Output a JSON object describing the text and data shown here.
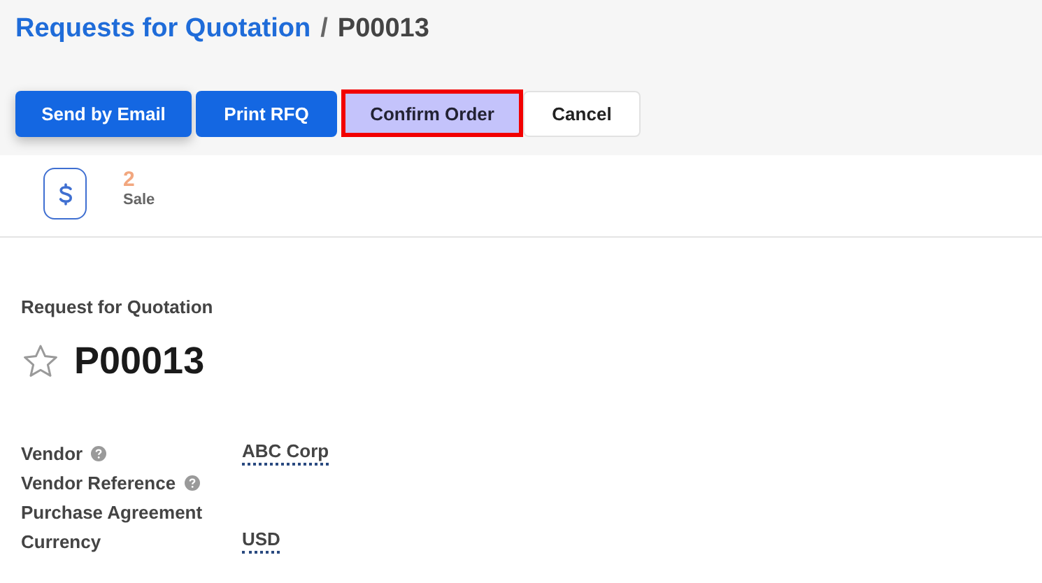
{
  "breadcrumb": {
    "parent": "Requests for Quotation",
    "separator": "/",
    "current": "P00013"
  },
  "buttons": [
    {
      "label": "Send by Email",
      "kind": "primary"
    },
    {
      "label": "Print RFQ",
      "kind": "primary"
    },
    {
      "label": "Confirm Order",
      "kind": "highlight"
    },
    {
      "label": "Cancel",
      "kind": "secondary"
    }
  ],
  "smart_button": {
    "count": "2",
    "label": "Sale"
  },
  "form": {
    "subtitle": "Request for Quotation",
    "name": "P00013",
    "starred": false,
    "fields": [
      {
        "label": "Vendor",
        "help": true,
        "value": "ABC Corp"
      },
      {
        "label": "Vendor Reference",
        "help": true
      },
      {
        "label": "Purchase Agreement",
        "help": false
      },
      {
        "label": "Currency",
        "help": false,
        "value": "USD"
      }
    ]
  }
}
